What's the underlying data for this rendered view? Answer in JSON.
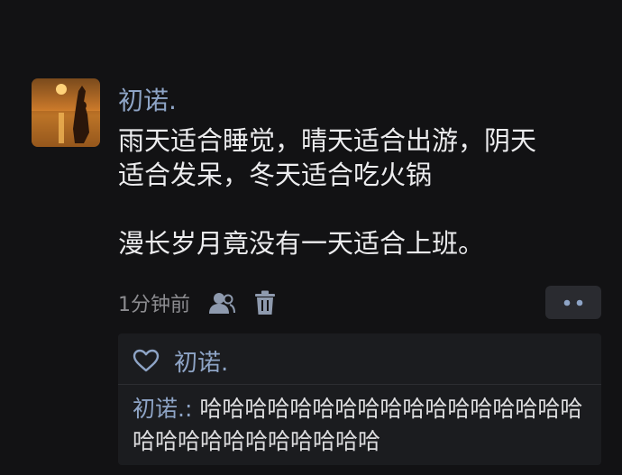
{
  "post": {
    "author": "初诺.",
    "lines": [
      "雨天适合睡觉，晴天适合出游，阴天",
      "适合发呆，冬天适合吃火锅"
    ],
    "line2": "漫长岁月竟没有一天适合上班。",
    "time": "1分钟前"
  },
  "actions": {
    "user_icon": "person-icon",
    "delete_icon": "trash-icon",
    "more_icon": "more-dots-icon"
  },
  "comments_panel": {
    "like_icon": "heart-outline-icon",
    "liker": "初诺.",
    "comment_author": "初诺.",
    "comment_separator": ": ",
    "comment_text": "哈哈哈哈哈哈哈哈哈哈哈哈哈哈哈哈哈哈哈哈哈哈哈哈哈哈哈哈"
  },
  "colors": {
    "background": "#121214",
    "name_blue": "#8ea4c6",
    "panel": "#1b1c1f",
    "button": "#2a2b30"
  }
}
